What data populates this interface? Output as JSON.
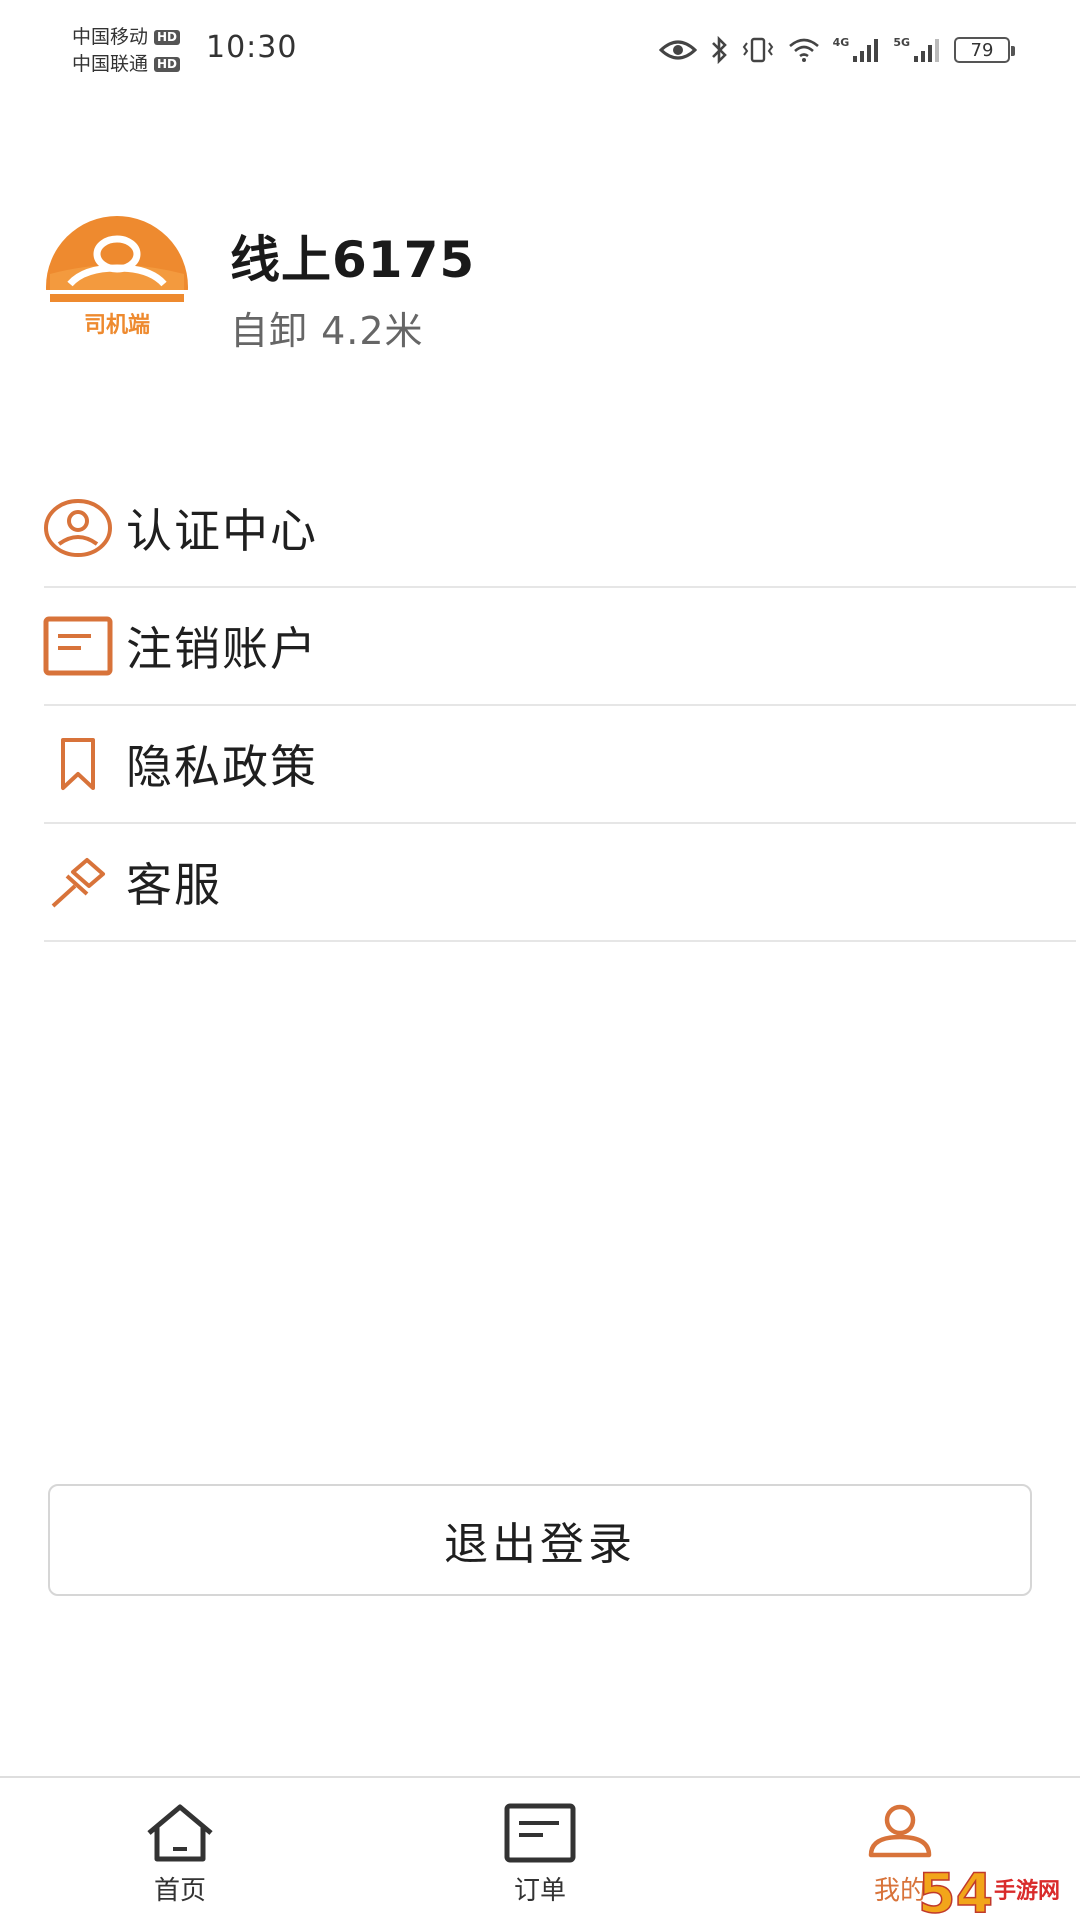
{
  "status_bar": {
    "carrier1": "中国移动",
    "carrier2": "中国联通",
    "hd_badge": "HD",
    "time": "10:30",
    "net1": "4G",
    "net2": "5G",
    "battery": "79"
  },
  "profile": {
    "logo_text": "司机端",
    "name": "线上6175",
    "vehicle": "自卸 4.2米"
  },
  "menu": {
    "items": [
      {
        "label": "认证中心",
        "icon": "user-circle-icon"
      },
      {
        "label": "注销账户",
        "icon": "document-icon"
      },
      {
        "label": "隐私政策",
        "icon": "bookmark-icon"
      },
      {
        "label": "客服",
        "icon": "pin-icon"
      }
    ]
  },
  "logout_label": "退出登录",
  "bottom_nav": {
    "items": [
      {
        "label": "首页",
        "icon": "home-icon"
      },
      {
        "label": "订单",
        "icon": "order-icon"
      },
      {
        "label": "我的",
        "icon": "person-icon",
        "active": true
      }
    ]
  },
  "colors": {
    "accent": "#d8733a",
    "logo_orange": "#ee8a2f",
    "divider": "#e6e6e6"
  },
  "watermark": {
    "text": "54",
    "sub": "手游网"
  }
}
